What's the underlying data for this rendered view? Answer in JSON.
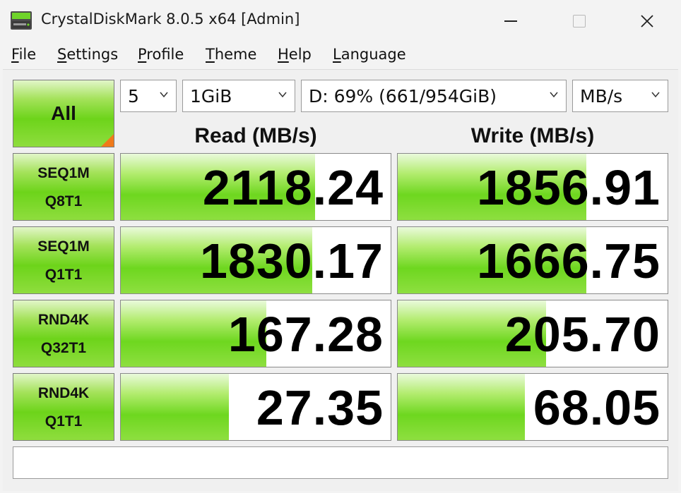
{
  "window": {
    "title": "CrystalDiskMark 8.0.5 x64 [Admin]"
  },
  "menu": [
    {
      "key": "F",
      "rest": "ile"
    },
    {
      "key": "S",
      "rest": "ettings"
    },
    {
      "key": "P",
      "rest": "rofile"
    },
    {
      "key": "T",
      "rest": "heme"
    },
    {
      "key": "H",
      "rest": "elp"
    },
    {
      "key": "L",
      "rest": "anguage"
    }
  ],
  "controls": {
    "all_label": "All",
    "count": "5",
    "size": "1GiB",
    "drive": "D: 69% (661/954GiB)",
    "unit": "MB/s"
  },
  "headers": {
    "read": "Read (MB/s)",
    "write": "Write (MB/s)"
  },
  "rows": [
    {
      "line1": "SEQ1M",
      "line2": "Q8T1",
      "read": "2118.24",
      "write": "1856.91",
      "read_level": 0.72,
      "write_level": 0.7
    },
    {
      "line1": "SEQ1M",
      "line2": "Q1T1",
      "read": "1830.17",
      "write": "1666.75",
      "read_level": 0.71,
      "write_level": 0.7
    },
    {
      "line1": "RND4K",
      "line2": "Q32T1",
      "read": "167.28",
      "write": "205.70",
      "read_level": 0.54,
      "write_level": 0.55
    },
    {
      "line1": "RND4K",
      "line2": "Q1T1",
      "read": "27.35",
      "write": "68.05",
      "read_level": 0.4,
      "write_level": 0.47
    }
  ],
  "comment": "",
  "colors": {
    "accent_green": "#6dd41a",
    "corner_orange": "#f07a1a"
  },
  "icons": [
    "app-drive-icon",
    "minimize-icon",
    "maximize-icon",
    "close-icon",
    "chevron-down-icon"
  ]
}
